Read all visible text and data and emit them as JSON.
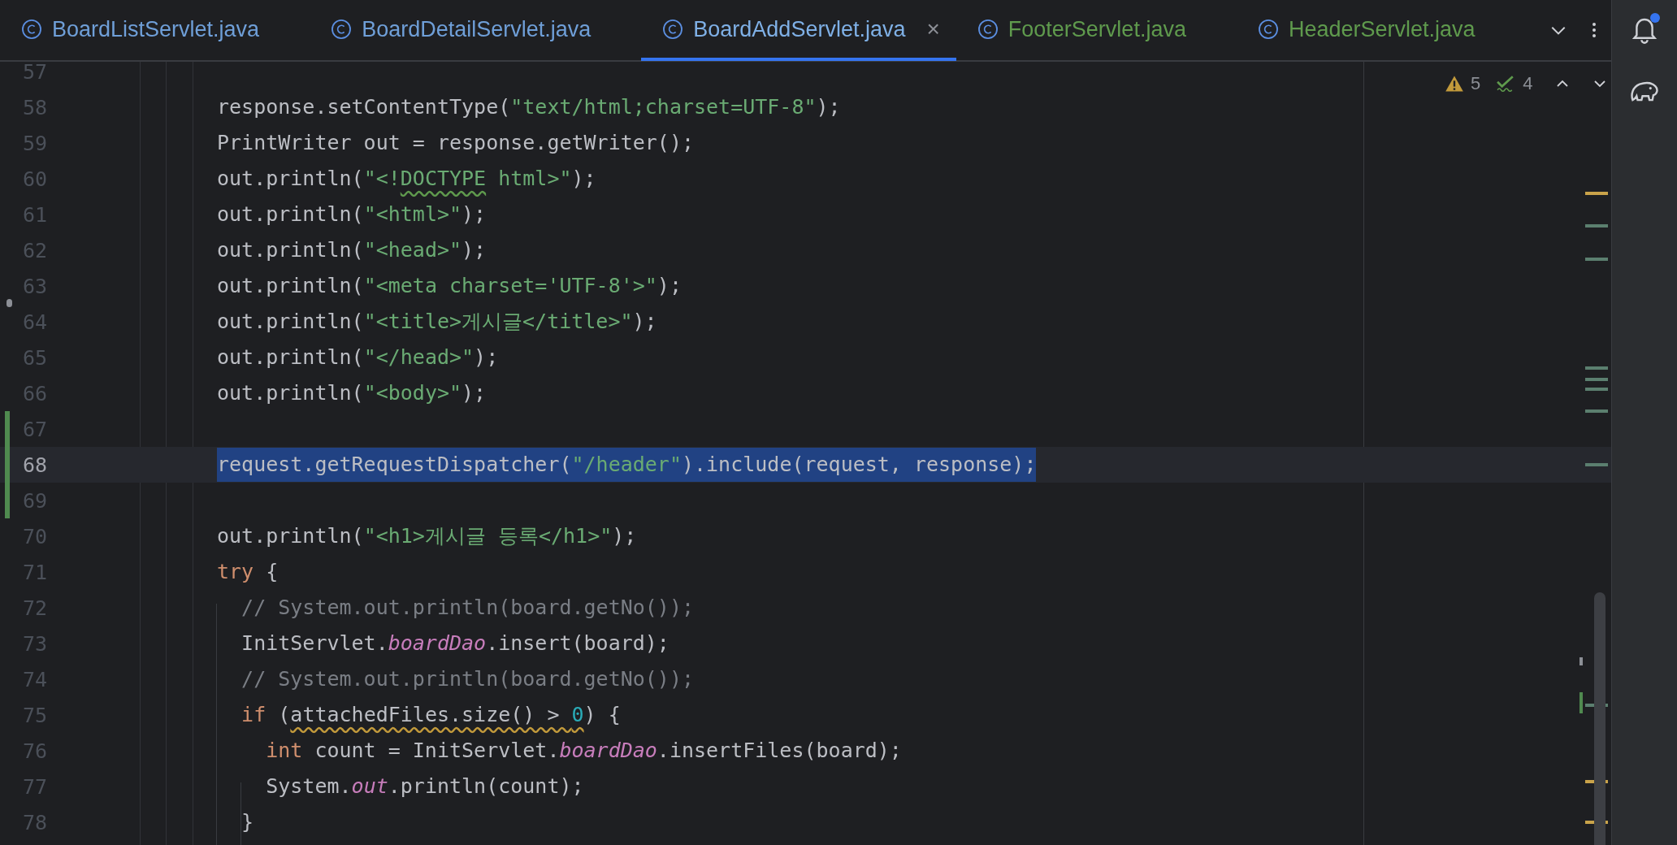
{
  "tabs": [
    {
      "label": "BoardListServlet.java",
      "selected": false,
      "color": "#6f9fd8"
    },
    {
      "label": "BoardDetailServlet.java",
      "selected": false,
      "color": "#6f9fd8"
    },
    {
      "label": "BoardAddServlet.java",
      "selected": true,
      "color": "#7fb0e6",
      "close_icon": "×"
    },
    {
      "label": "FooterServlet.java",
      "selected": false,
      "color": "#5f9a4d"
    },
    {
      "label": "HeaderServlet.java",
      "selected": false,
      "color": "#5f9a4d"
    }
  ],
  "inspections": {
    "warnings": "5",
    "typos": "4"
  },
  "notifications": {
    "unread": true
  },
  "lines": [
    {
      "number": "57",
      "selected": false,
      "changed": false
    },
    {
      "number": "58",
      "selected": false,
      "changed": false,
      "segments": [
        {
          "kind": "plain",
          "text": "response.setContentType("
        },
        {
          "kind": "string",
          "text": "\"text/html;charset=UTF-8\""
        },
        {
          "kind": "plain",
          "text": ");"
        }
      ]
    },
    {
      "number": "59",
      "selected": false,
      "changed": false,
      "segments": [
        {
          "kind": "plain",
          "text": "PrintWriter out = response.getWriter();"
        }
      ]
    },
    {
      "number": "60",
      "selected": false,
      "changed": false,
      "segments": [
        {
          "kind": "plain",
          "text": "out.println("
        },
        {
          "kind": "string",
          "text": "\"<!"
        },
        {
          "kind": "string",
          "text": "DOCTYPE",
          "typo": true
        },
        {
          "kind": "string",
          "text": " html>\""
        },
        {
          "kind": "plain",
          "text": ");"
        }
      ]
    },
    {
      "number": "61",
      "selected": false,
      "changed": false,
      "segments": [
        {
          "kind": "plain",
          "text": "out.println("
        },
        {
          "kind": "string",
          "text": "\"<html>\""
        },
        {
          "kind": "plain",
          "text": ");"
        }
      ]
    },
    {
      "number": "62",
      "selected": false,
      "changed": false,
      "segments": [
        {
          "kind": "plain",
          "text": "out.println("
        },
        {
          "kind": "string",
          "text": "\"<head>\""
        },
        {
          "kind": "plain",
          "text": ");"
        }
      ]
    },
    {
      "number": "63",
      "selected": false,
      "changed": false,
      "segments": [
        {
          "kind": "plain",
          "text": "out.println("
        },
        {
          "kind": "string",
          "text": "\"<meta charset='UTF-8'>\""
        },
        {
          "kind": "plain",
          "text": ");"
        }
      ]
    },
    {
      "number": "64",
      "selected": false,
      "changed": false,
      "segments": [
        {
          "kind": "plain",
          "text": "out.println("
        },
        {
          "kind": "string",
          "text": "\"<title>게시글</title>\""
        },
        {
          "kind": "plain",
          "text": ");"
        }
      ]
    },
    {
      "number": "65",
      "selected": false,
      "changed": false,
      "segments": [
        {
          "kind": "plain",
          "text": "out.println("
        },
        {
          "kind": "string",
          "text": "\"</head>\""
        },
        {
          "kind": "plain",
          "text": ");"
        }
      ]
    },
    {
      "number": "66",
      "selected": false,
      "changed": false,
      "segments": [
        {
          "kind": "plain",
          "text": "out.println("
        },
        {
          "kind": "string",
          "text": "\"<body>\""
        },
        {
          "kind": "plain",
          "text": ");"
        }
      ]
    },
    {
      "number": "67",
      "selected": false,
      "changed": true
    },
    {
      "number": "68",
      "selected": true,
      "changed": true,
      "segments": [
        {
          "kind": "plain",
          "text": "request.getRequestDispatcher("
        },
        {
          "kind": "string",
          "text": "\"/header\""
        },
        {
          "kind": "plain",
          "text": ").include(request, response);"
        }
      ]
    },
    {
      "number": "69",
      "selected": false,
      "changed": true
    },
    {
      "number": "70",
      "selected": false,
      "changed": false,
      "segments": [
        {
          "kind": "plain",
          "text": "out.println("
        },
        {
          "kind": "string",
          "text": "\"<h1>게시글 등록</h1>\""
        },
        {
          "kind": "plain",
          "text": ");"
        }
      ]
    },
    {
      "number": "71",
      "selected": false,
      "changed": false,
      "segments": [
        {
          "kind": "keyword",
          "text": "try"
        },
        {
          "kind": "plain",
          "text": " {"
        }
      ]
    },
    {
      "number": "72",
      "selected": false,
      "changed": false,
      "segments": [
        {
          "kind": "comment",
          "text": "  // System.out.println(board.getNo());"
        }
      ]
    },
    {
      "number": "73",
      "selected": false,
      "changed": false,
      "segments": [
        {
          "kind": "plain",
          "text": "  InitServlet."
        },
        {
          "kind": "static",
          "text": "boardDao"
        },
        {
          "kind": "plain",
          "text": ".insert(board);"
        }
      ]
    },
    {
      "number": "74",
      "selected": false,
      "changed": false,
      "segments": [
        {
          "kind": "comment",
          "text": "  // System.out.println(board.getNo());"
        }
      ]
    },
    {
      "number": "75",
      "selected": false,
      "changed": false,
      "segments": [
        {
          "kind": "keyword",
          "text": "  if"
        },
        {
          "kind": "plain",
          "text": " ("
        },
        {
          "kind": "plain",
          "text": "attachedFiles.size() > ",
          "warning": true
        },
        {
          "kind": "number",
          "text": "0",
          "warning": true
        },
        {
          "kind": "plain",
          "text": ") {"
        }
      ]
    },
    {
      "number": "76",
      "selected": false,
      "changed": false,
      "segments": [
        {
          "kind": "keyword",
          "text": "    int"
        },
        {
          "kind": "plain",
          "text": " count = InitServlet."
        },
        {
          "kind": "static",
          "text": "boardDao"
        },
        {
          "kind": "plain",
          "text": ".insertFiles(board);"
        }
      ]
    },
    {
      "number": "77",
      "selected": false,
      "changed": false,
      "segments": [
        {
          "kind": "plain",
          "text": "    System."
        },
        {
          "kind": "static",
          "text": "out"
        },
        {
          "kind": "plain",
          "text": ".println(count);"
        }
      ]
    },
    {
      "number": "78",
      "selected": false,
      "changed": false,
      "segments": [
        {
          "kind": "plain",
          "text": "  }"
        }
      ]
    }
  ]
}
